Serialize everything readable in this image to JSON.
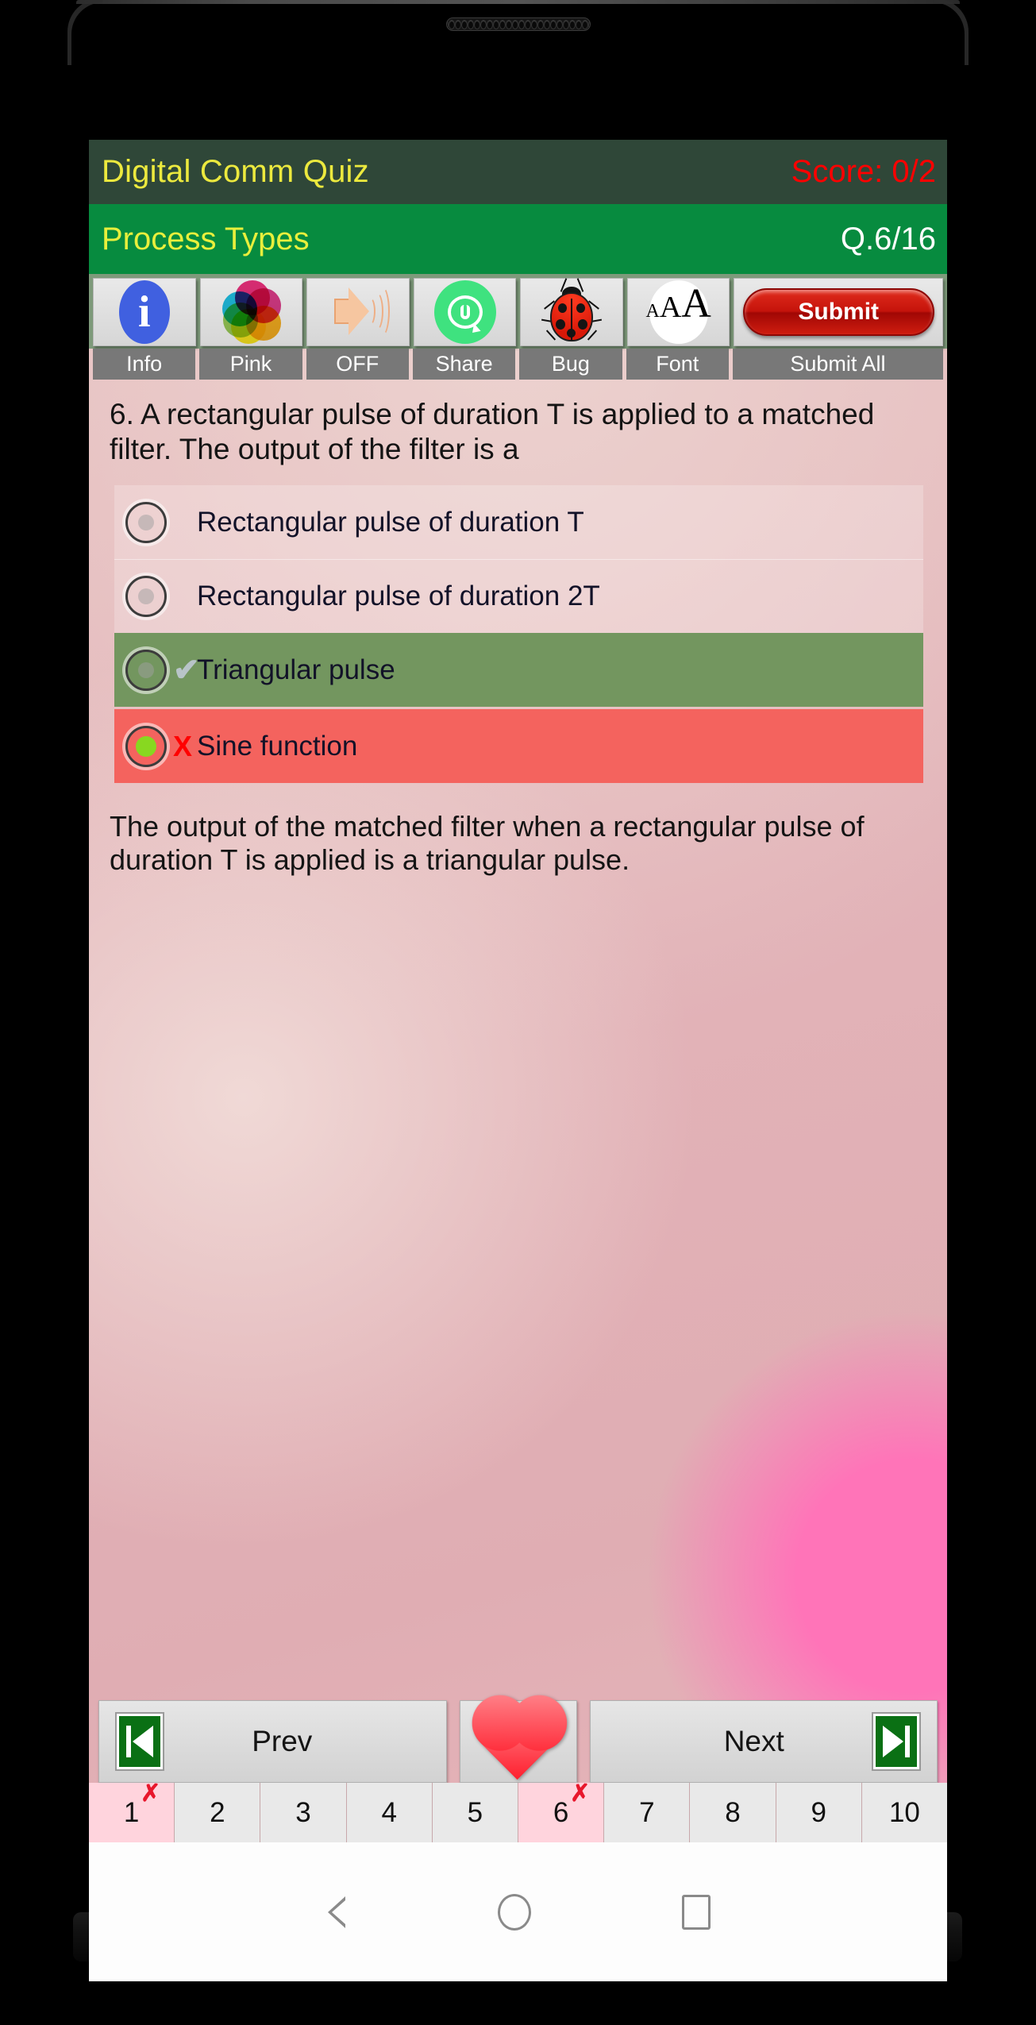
{
  "header": {
    "quiz_title": "Digital Comm Quiz",
    "score": "Score: 0/2",
    "topic": "Process Types",
    "question_counter": "Q.6/16",
    "title_bg": "#2f4738",
    "subtitle_bg": "#078b3f",
    "title_color": "#ece93e",
    "score_color": "#ff0000"
  },
  "toolbar": {
    "items": [
      {
        "label": "Info",
        "icon": "info-icon"
      },
      {
        "label": "Pink",
        "icon": "color-palette-icon"
      },
      {
        "label": "OFF",
        "icon": "speaker-icon"
      },
      {
        "label": "Share",
        "icon": "whatsapp-share-icon"
      },
      {
        "label": "Bug",
        "icon": "ladybug-icon"
      },
      {
        "label": "Font",
        "icon": "font-size-icon"
      },
      {
        "label": "Submit All",
        "icon": "submit-icon",
        "button_label": "Submit"
      }
    ]
  },
  "question": {
    "text": "6. A rectangular pulse of duration T is applied to a matched filter. The output of the filter is a",
    "options": [
      {
        "label": "Rectangular pulse of duration T",
        "state": "plain",
        "mark": "",
        "selected": false
      },
      {
        "label": "Rectangular pulse of duration 2T",
        "state": "plain",
        "mark": "",
        "selected": false
      },
      {
        "label": "Triangular pulse",
        "state": "correct",
        "mark": "✔",
        "selected": false
      },
      {
        "label": "Sine function",
        "state": "wrong",
        "mark": "X",
        "selected": true
      }
    ],
    "explanation": "The output of the matched filter when a rectangular pulse of duration T is applied is a triangular pulse."
  },
  "nav": {
    "prev_label": "Prev",
    "next_label": "Next",
    "favorite_icon": "heart-icon",
    "prev_icon": "skip-previous-icon",
    "next_icon": "skip-next-icon"
  },
  "pagination": {
    "pages": [
      {
        "number": "1",
        "marked": true,
        "x": "✗"
      },
      {
        "number": "2",
        "marked": false,
        "x": ""
      },
      {
        "number": "3",
        "marked": false,
        "x": ""
      },
      {
        "number": "4",
        "marked": false,
        "x": ""
      },
      {
        "number": "5",
        "marked": false,
        "x": ""
      },
      {
        "number": "6",
        "marked": true,
        "x": "✗"
      },
      {
        "number": "7",
        "marked": false,
        "x": ""
      },
      {
        "number": "8",
        "marked": false,
        "x": ""
      },
      {
        "number": "9",
        "marked": false,
        "x": ""
      },
      {
        "number": "10",
        "marked": false,
        "x": ""
      }
    ]
  },
  "system_nav": {
    "back": "back-icon",
    "home": "home-icon",
    "recents": "recents-icon"
  },
  "colors": {
    "correct_bg": "#73965f",
    "wrong_bg": "#f4635e",
    "accent_pink": "#ff74b8",
    "submit_red": "#c5130b"
  }
}
